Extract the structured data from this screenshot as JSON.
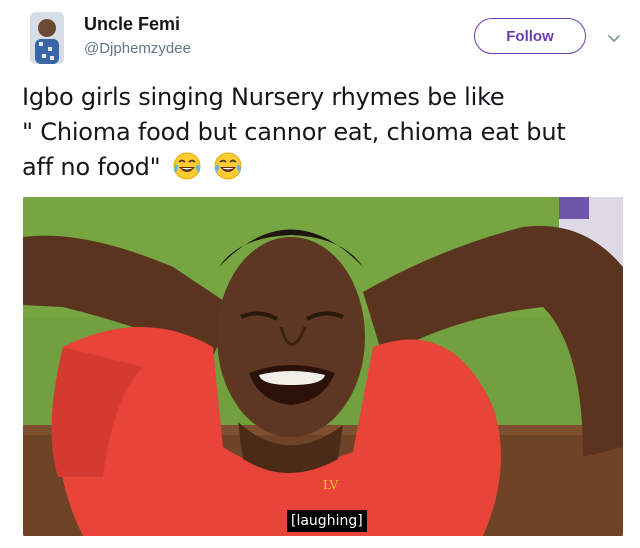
{
  "author": {
    "name": "Uncle Femi",
    "handle": "@Djphemzydee"
  },
  "actions": {
    "follow_label": "Follow",
    "more_icon": "chevron-down-icon"
  },
  "tweet": {
    "lines": [
      "Igbo girls singing Nursery rhymes be like",
      "\" Chioma food but cannor eat, chioma eat but",
      "aff no food\""
    ],
    "emojis": [
      "face-with-tears-of-joy",
      "face-with-tears-of-joy"
    ]
  },
  "media": {
    "subtitle": "[laughing]"
  },
  "colors": {
    "accent": "#6d3bb0",
    "handle": "#657786",
    "text": "#14171a",
    "shirt": "#e8443a",
    "background_wall": "#6f9b3e"
  }
}
